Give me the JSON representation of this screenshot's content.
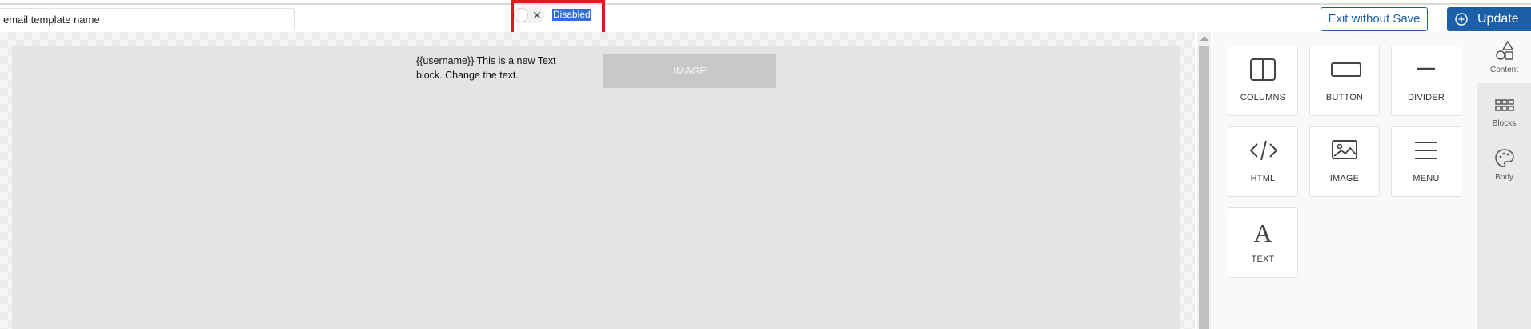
{
  "header": {
    "template_name_placeholder": "email template name",
    "status_label": "Disabled",
    "exit_label": "Exit without Save",
    "update_label": "Update",
    "toggle_state": "off",
    "highlight_color": "#e0191e",
    "accent_color": "#1a5fa8"
  },
  "canvas": {
    "text_block": "{{username}} This is a new Text block. Change the text.",
    "image_placeholder": "IMAGE"
  },
  "content_panel": {
    "tiles": [
      {
        "label": "COLUMNS",
        "icon": "columns-icon"
      },
      {
        "label": "BUTTON",
        "icon": "button-icon"
      },
      {
        "label": "DIVIDER",
        "icon": "divider-icon"
      },
      {
        "label": "HTML",
        "icon": "html-code-icon"
      },
      {
        "label": "IMAGE",
        "icon": "image-icon"
      },
      {
        "label": "MENU",
        "icon": "menu-icon"
      },
      {
        "label": "TEXT",
        "icon": "text-icon"
      }
    ]
  },
  "side_tabs": [
    {
      "label": "Content",
      "icon": "shapes-icon",
      "active": true
    },
    {
      "label": "Blocks",
      "icon": "grid-icon",
      "active": false
    },
    {
      "label": "Body",
      "icon": "palette-icon",
      "active": false
    }
  ]
}
